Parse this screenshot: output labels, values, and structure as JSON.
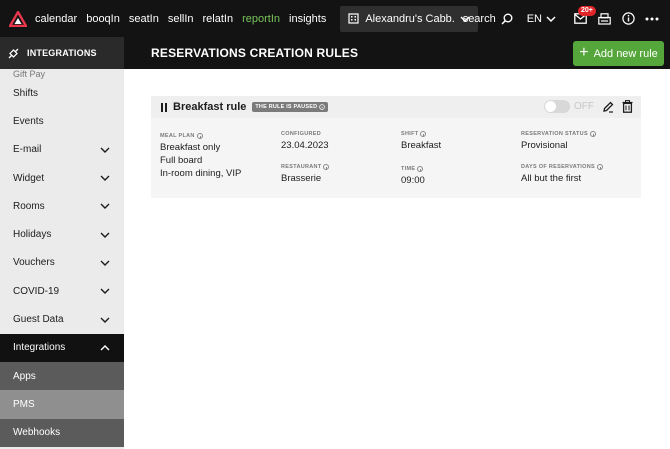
{
  "topbar": {
    "nav": [
      "calendar",
      "booqIn",
      "seatIn",
      "sellIn",
      "relatIn",
      "reportIn",
      "insights"
    ],
    "active_nav": "reportIn",
    "venue": "Alexandru's Cabb...",
    "search_label": "search",
    "language": "EN",
    "notifications_count": "20+"
  },
  "sidebar": {
    "header": "INTEGRATIONS",
    "cut_item": "Gift Pay",
    "items": [
      {
        "label": "Shifts",
        "expandable": false
      },
      {
        "label": "Events",
        "expandable": false
      },
      {
        "label": "E-mail",
        "expandable": true
      },
      {
        "label": "Widget",
        "expandable": true
      },
      {
        "label": "Rooms",
        "expandable": true
      },
      {
        "label": "Holidays",
        "expandable": true
      },
      {
        "label": "Vouchers",
        "expandable": true
      },
      {
        "label": "COVID-19",
        "expandable": true
      },
      {
        "label": "Guest Data",
        "expandable": true
      },
      {
        "label": "Integrations",
        "expandable": true
      }
    ],
    "sub_items": [
      {
        "label": "Apps"
      },
      {
        "label": "PMS"
      },
      {
        "label": "Webhooks"
      }
    ],
    "selected_sub": "PMS"
  },
  "page": {
    "title": "RESERVATIONS CREATION RULES",
    "add_button": "Add new rule"
  },
  "rule": {
    "name": "Breakfast rule",
    "paused_badge": "THE RULE IS PAUSED",
    "toggle_label": "OFF",
    "toggle_on": false,
    "fields": {
      "meal_plan": {
        "label": "MEAL PLAN",
        "values": [
          "Breakfast only",
          "Full board",
          "In-room dining, VIP"
        ]
      },
      "configured": {
        "label": "CONFIGURED",
        "value": "23.04.2023"
      },
      "restaurant": {
        "label": "RESTAURANT",
        "value": "Brasserie"
      },
      "shift": {
        "label": "SHIFT",
        "value": "Breakfast"
      },
      "time": {
        "label": "TIME",
        "value": "09:00"
      },
      "reservation_status": {
        "label": "RESERVATION STATUS",
        "value": "Provisional"
      },
      "days_of_reservations": {
        "label": "DAYS OF RESERVATIONS",
        "value": "All but the first"
      }
    }
  },
  "colors": {
    "topbar_bg": "#131313",
    "accent_green": "#55a63b",
    "active_nav": "#78c45a",
    "badge_red": "#e0262b"
  }
}
